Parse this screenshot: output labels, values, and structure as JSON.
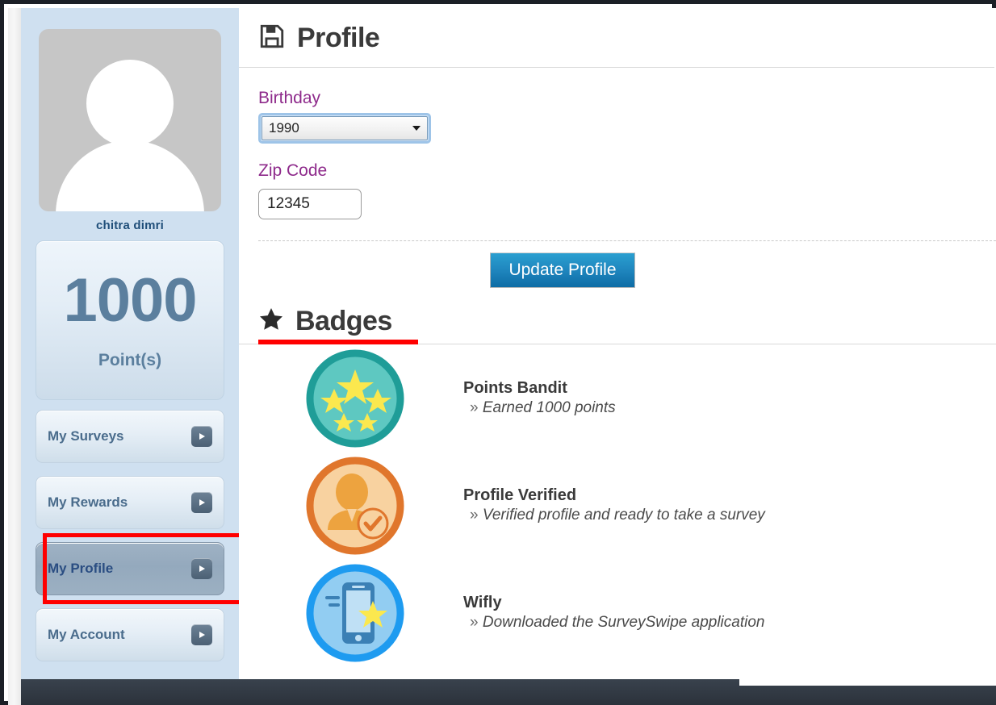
{
  "sidebar": {
    "avatar_alt": "default user avatar",
    "username": "chitra dimri",
    "points": {
      "value": "1000",
      "label": "Point(s)"
    },
    "nav": [
      {
        "label": "My Surveys",
        "active": false
      },
      {
        "label": "My Rewards",
        "active": false
      },
      {
        "label": "My Profile",
        "active": true
      },
      {
        "label": "My Account",
        "active": false
      }
    ]
  },
  "header": {
    "title": "Profile",
    "icon": "save-floppy-icon"
  },
  "form": {
    "birthday": {
      "label": "Birthday",
      "value": "1990"
    },
    "zip": {
      "label": "Zip Code",
      "value": "12345",
      "placeholder": "12345"
    },
    "update_button": "Update Profile"
  },
  "badges_section": {
    "title": "Badges",
    "icon": "star-icon",
    "items": [
      {
        "name": "Points Bandit",
        "desc": "Earned 1000 points",
        "icon": "five-stars-badge-icon",
        "ring_color": "#1f9d98",
        "fill_color": "#5ec8c1"
      },
      {
        "name": "Profile Verified",
        "desc": "Verified profile and ready to take a survey",
        "icon": "verified-person-badge-icon",
        "ring_color": "#e0762c",
        "fill_color": "#f8d2a0"
      },
      {
        "name": "Wifly",
        "desc": "Downloaded the SurveySwipe application",
        "icon": "mobile-star-badge-icon",
        "ring_color": "#1e9bf0",
        "fill_color": "#92cdf2"
      }
    ],
    "desc_prefix": "»"
  },
  "annotation": {
    "highlight_target": "My Profile",
    "highlight_color": "#ff0000"
  }
}
